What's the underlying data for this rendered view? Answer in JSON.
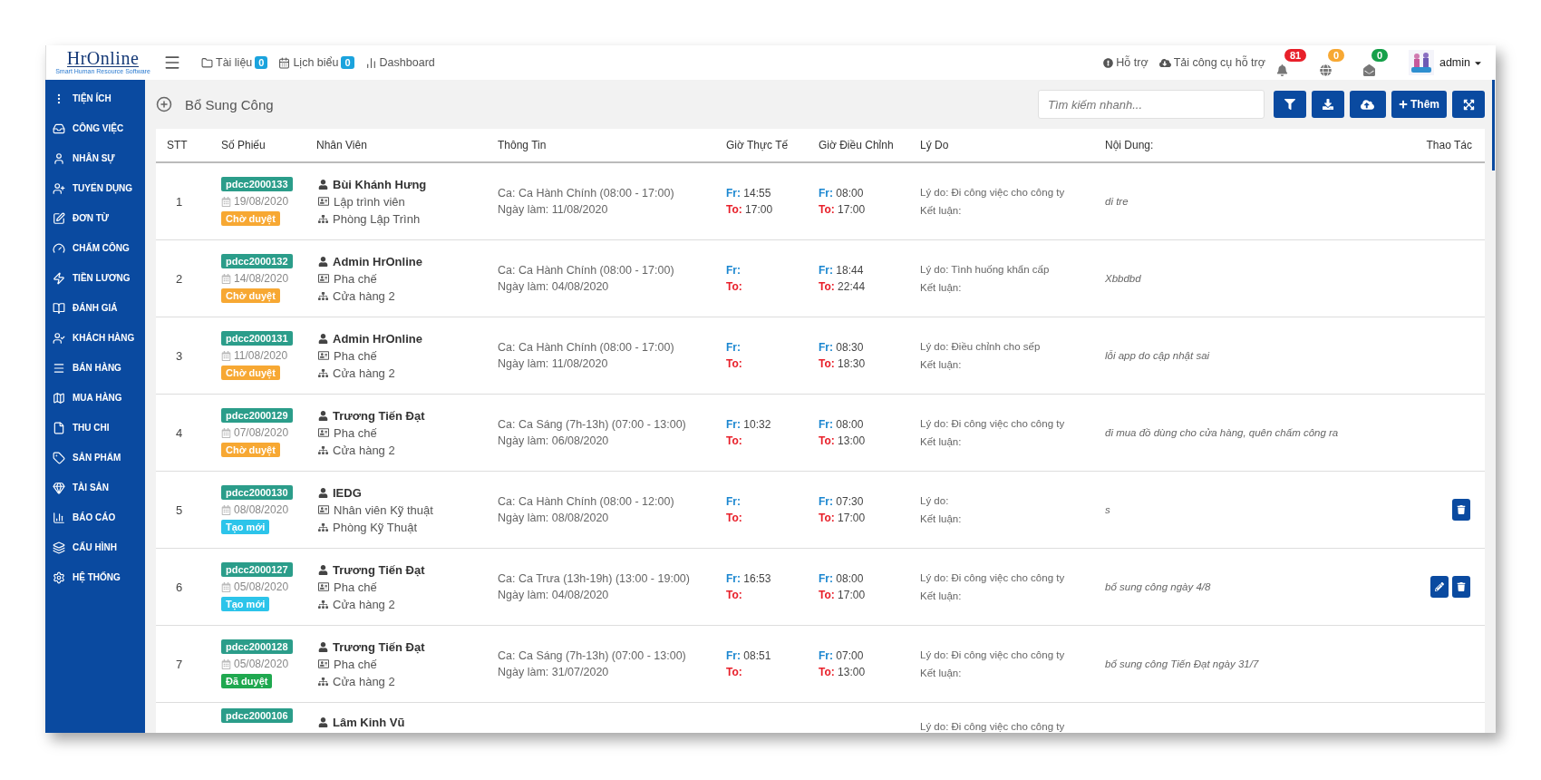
{
  "header": {
    "logo": "HrOnline",
    "logo_tagline": "Smart Human Resource Software",
    "nav": [
      {
        "label": "Tài liệu",
        "count": "0"
      },
      {
        "label": "Lịch biểu",
        "count": "0"
      },
      {
        "label": "Dashboard"
      }
    ],
    "links": [
      "Hỗ trợ",
      "Tải công cụ hỗ trợ"
    ],
    "alerts": [
      {
        "count": "81",
        "color": "#e8202a"
      },
      {
        "count": "0",
        "color": "#f7a833"
      },
      {
        "count": "0",
        "color": "#16a04a"
      }
    ],
    "user": "admin"
  },
  "sidebar": {
    "items": [
      {
        "label": "TIỆN ÍCH"
      },
      {
        "label": "CÔNG VIỆC"
      },
      {
        "label": "NHÂN SỰ"
      },
      {
        "label": "TUYỂN DỤNG"
      },
      {
        "label": "ĐƠN TỪ"
      },
      {
        "label": "CHẤM CÔNG"
      },
      {
        "label": "TIỀN LƯƠNG"
      },
      {
        "label": "ĐÁNH GIÁ"
      },
      {
        "label": "KHÁCH HÀNG"
      },
      {
        "label": "BÁN HÀNG"
      },
      {
        "label": "MUA HÀNG"
      },
      {
        "label": "THU CHI"
      },
      {
        "label": "SẢN PHẨM"
      },
      {
        "label": "TÀI SẢN"
      },
      {
        "label": "BÁO CÁO"
      },
      {
        "label": "CẤU HÌNH"
      },
      {
        "label": "HỆ THỐNG"
      }
    ]
  },
  "page": {
    "title": "Bổ Sung Công",
    "search": {
      "placeholder": "Tìm kiếm nhanh..."
    },
    "add_button": "Thêm"
  },
  "table": {
    "columns": [
      "STT",
      "Số Phiếu",
      "Nhân Viên",
      "Thông Tin",
      "Giờ Thực Tế",
      "Giờ Điều Chỉnh",
      "Lý Do",
      "Nội Dung:",
      "Thao Tác"
    ],
    "rows": [
      {
        "stt": "1",
        "code": "pdcc2000133",
        "date": "19/08/2020",
        "status": {
          "label": "Chờ duyệt",
          "color": "#f7a833"
        },
        "name": "Bùi Khánh Hưng",
        "position": "Lập trình viên",
        "department": "Phòng Lập Trình",
        "shift": "Ca: Ca Hành Chính (08:00 - 17:00)",
        "work_date": "Ngày làm: 11/08/2020",
        "actual": {
          "fr_label": "Fr:",
          "from": "14:55",
          "to_label": "To:",
          "to": "17:00"
        },
        "adjusted": {
          "fr_label": "Fr:",
          "from": "08:00",
          "to_label": "To:",
          "to": "17:00"
        },
        "reason": "Lý do: Đi công việc cho công ty",
        "conclusion": "Kết luận:",
        "content": "di tre",
        "actions": []
      },
      {
        "stt": "2",
        "code": "pdcc2000132",
        "date": "14/08/2020",
        "status": {
          "label": "Chờ duyệt",
          "color": "#f7a833"
        },
        "name": "Admin HrOnline",
        "position": "Pha chế",
        "department": "Cửa hàng 2",
        "shift": "Ca: Ca Hành Chính (08:00 - 17:00)",
        "work_date": "Ngày làm: 04/08/2020",
        "actual": {
          "fr_label": "Fr:",
          "to_label": "To:"
        },
        "adjusted": {
          "fr_label": "Fr:",
          "from": "18:44",
          "to_label": "To:",
          "to": "22:44"
        },
        "reason": "Lý do: Tình huống khẩn cấp",
        "conclusion": "Kết luận:",
        "content": "Xbbdbd",
        "actions": []
      },
      {
        "stt": "3",
        "code": "pdcc2000131",
        "date": "11/08/2020",
        "status": {
          "label": "Chờ duyệt",
          "color": "#f7a833"
        },
        "name": "Admin HrOnline",
        "position": "Pha chế",
        "department": "Cửa hàng 2",
        "shift": "Ca: Ca Hành Chính (08:00 - 17:00)",
        "work_date": "Ngày làm: 11/08/2020",
        "actual": {
          "fr_label": "Fr:",
          "to_label": "To:"
        },
        "adjusted": {
          "fr_label": "Fr:",
          "from": "08:30",
          "to_label": "To:",
          "to": "18:30"
        },
        "reason": "Lý do: Điều chỉnh cho sếp",
        "conclusion": "Kết luận:",
        "content": "lỗi app do cập nhật sai",
        "actions": []
      },
      {
        "stt": "4",
        "code": "pdcc2000129",
        "date": "07/08/2020",
        "status": {
          "label": "Chờ duyệt",
          "color": "#f7a833"
        },
        "name": "Trương Tiến Đạt",
        "position": "Pha chế",
        "department": "Cửa hàng 2",
        "shift": "Ca: Ca Sáng (7h-13h) (07:00 - 13:00)",
        "work_date": "Ngày làm: 06/08/2020",
        "actual": {
          "fr_label": "Fr:",
          "from": "10:32",
          "to_label": "To:"
        },
        "adjusted": {
          "fr_label": "Fr:",
          "from": "08:00",
          "to_label": "To:",
          "to": "13:00"
        },
        "reason": "Lý do: Đi công việc cho công ty",
        "conclusion": "Kết luận:",
        "content": "đi mua đồ dùng cho cửa hàng, quên chấm công ra",
        "actions": []
      },
      {
        "stt": "5",
        "code": "pdcc2000130",
        "date": "08/08/2020",
        "status": {
          "label": "Tạo mới",
          "color": "#2cc4ea"
        },
        "name": "IEDG",
        "position": "Nhân viên Kỹ thuật",
        "department": "Phòng Kỹ Thuật",
        "shift": "Ca: Ca Hành Chính (08:00 - 12:00)",
        "work_date": "Ngày làm: 08/08/2020",
        "actual": {
          "fr_label": "Fr:",
          "to_label": "To:"
        },
        "adjusted": {
          "fr_label": "Fr:",
          "from": "07:30",
          "to_label": "To:",
          "to": "17:00"
        },
        "reason": "Lý do:",
        "conclusion": "Kết luận:",
        "content": "s",
        "actions": [
          {
            "kind": "delete"
          }
        ]
      },
      {
        "stt": "6",
        "code": "pdcc2000127",
        "date": "05/08/2020",
        "status": {
          "label": "Tạo mới",
          "color": "#2cc4ea"
        },
        "name": "Trương Tiến Đạt",
        "position": "Pha chế",
        "department": "Cửa hàng 2",
        "shift": "Ca: Ca Trưa (13h-19h) (13:00 - 19:00)",
        "work_date": "Ngày làm: 04/08/2020",
        "actual": {
          "fr_label": "Fr:",
          "from": "16:53",
          "to_label": "To:"
        },
        "adjusted": {
          "fr_label": "Fr:",
          "from": "08:00",
          "to_label": "To:",
          "to": "17:00"
        },
        "reason": "Lý do: Đi công việc cho công ty",
        "conclusion": "Kết luận:",
        "content": "bổ sung công ngày 4/8",
        "actions": [
          {
            "kind": "edit"
          },
          {
            "kind": "delete"
          }
        ]
      },
      {
        "stt": "7",
        "code": "pdcc2000128",
        "date": "05/08/2020",
        "status": {
          "label": "Đã duyệt",
          "color": "#1fa84f"
        },
        "name": "Trương Tiến Đạt",
        "position": "Pha chế",
        "department": "Cửa hàng 2",
        "shift": "Ca: Ca Sáng (7h-13h) (07:00 - 13:00)",
        "work_date": "Ngày làm: 31/07/2020",
        "actual": {
          "fr_label": "Fr:",
          "from": "08:51",
          "to_label": "To:"
        },
        "adjusted": {
          "fr_label": "Fr:",
          "from": "07:00",
          "to_label": "To:",
          "to": "13:00"
        },
        "reason": "Lý do: Đi công việc cho công ty",
        "conclusion": "Kết luận:",
        "content": "bổ sung công Tiến Đạt ngày 31/7",
        "actions": []
      }
    ],
    "partial_row": {
      "code": "pdcc2000106",
      "name": "Lâm Kinh Vũ",
      "reason": "Lý do: Đi công việc cho công ty"
    }
  }
}
